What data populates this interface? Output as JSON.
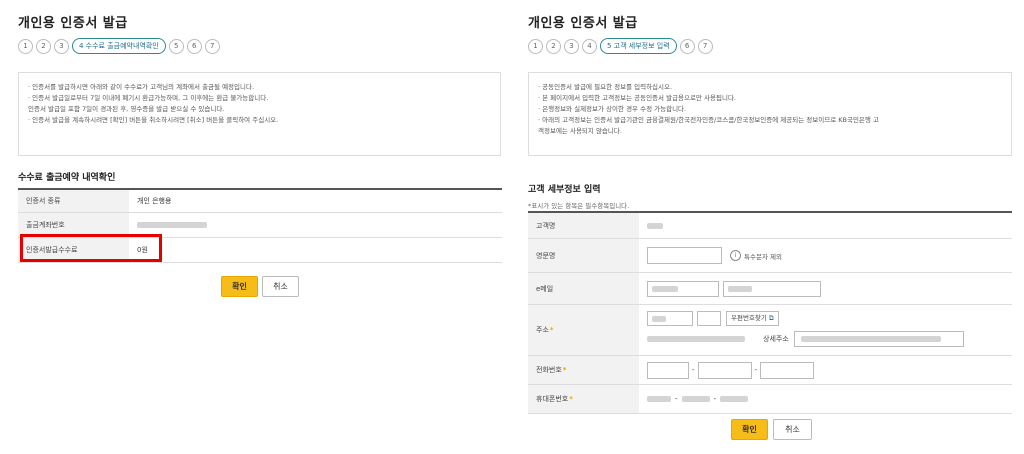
{
  "left": {
    "title": "개인용 인증서 발급",
    "steps": [
      "1",
      "2",
      "3",
      "4 수수료 출금예약내역확인",
      "5",
      "6",
      "7"
    ],
    "notice": [
      "· 인증서를 발급하시면 아래와 같이 수수료가 고객님의 계좌에서 출금될 예정입니다.",
      "· 인증서 발급일로부터 7일 이내에 폐기시 환급가능하며, 그 이후에는 환급 불가능합니다.",
      "  인증서 발급일 포함 7일이 경과된 후, 영수증을 발급 받으실 수 있습니다.",
      "· 인증서 발급을 계속하시려면 [확인] 버튼을 취소하시려면 [취소] 버튼을 클릭하여 주십시오."
    ],
    "section_title": "수수료 출금예약 내역확인",
    "rows": [
      {
        "label": "인증서 종류",
        "value": "개인 은행용"
      },
      {
        "label": "출금계좌번호",
        "value": ""
      },
      {
        "label": "인증서발급수수료",
        "value": "0원"
      }
    ],
    "confirm": "확인",
    "cancel": "취소"
  },
  "right": {
    "title": "개인용 인증서 발급",
    "steps": [
      "1",
      "2",
      "3",
      "4",
      "5 고객 세부정보 입력",
      "6",
      "7"
    ],
    "notice": [
      "· 공동인증서 발급에 필요한 정보를 입력하십시오.",
      "· 본 페이지에서 입력한 고객정보는 공동인증서 발급용으로만 사용됩니다.",
      "· 은행정보와 실제정보가 상이한 경우 수정 가능합니다.",
      "· 아래의 고객정보는 인증서 발급기관인 금융결제원/한국전자인증/코스콤/한국정보인증에 제공되는 정보이므로 KB국민은행 고",
      "  객정보에는 사용되지 않습니다."
    ],
    "section_title": "고객 세부정보 입력",
    "required_note": "*표시가 있는 항목은 필수항목입니다.",
    "labels": {
      "name": "고객명",
      "english_name": "영문명",
      "email": "e메일",
      "address": "주소",
      "phone": "전화번호",
      "mobile": "휴대폰번호",
      "detail_address": "상세주소"
    },
    "english_hint": "특수문자 제외",
    "postcode_button": "우편번호찾기",
    "dash": "-",
    "star": "*",
    "confirm": "확인",
    "cancel": "취소"
  }
}
